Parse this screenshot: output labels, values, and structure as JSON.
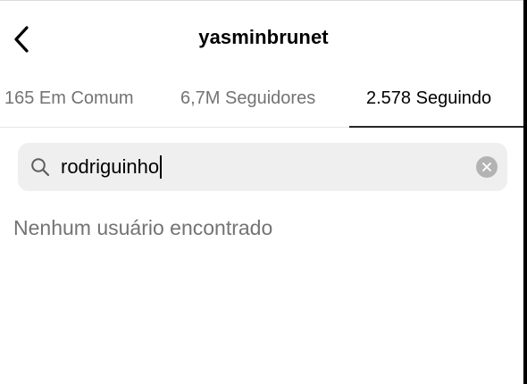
{
  "header": {
    "title": "yasminbrunet",
    "back_icon": "chevron-left-icon"
  },
  "tabs": [
    {
      "label": "165 Em Comum",
      "active": false
    },
    {
      "label": "6,7M Seguidores",
      "active": false
    },
    {
      "label": "2.578 Seguindo",
      "active": true
    }
  ],
  "search": {
    "value": "rodriguinho",
    "icon": "search-icon",
    "clear_icon": "clear-icon"
  },
  "results": {
    "empty_message": "Nenhum usuário encontrado"
  },
  "colors": {
    "text_primary": "#000000",
    "text_secondary": "#737373",
    "search_background": "#efefef",
    "clear_button": "#b3b3b3",
    "active_tab_indicator": "#262626"
  }
}
